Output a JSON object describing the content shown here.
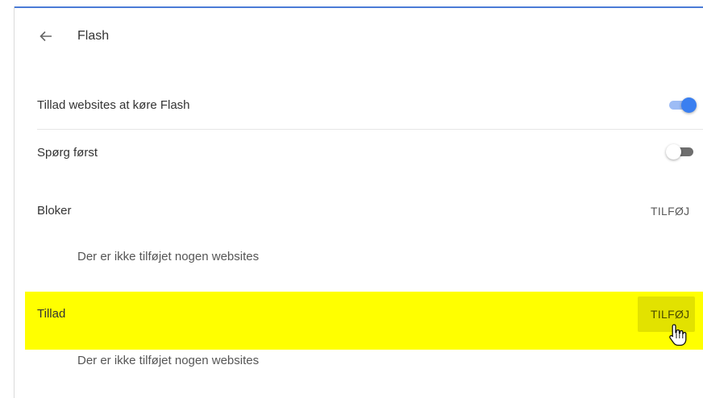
{
  "header": {
    "title": "Flash",
    "back_icon": "arrow-left-icon"
  },
  "settings": {
    "allow_flash": {
      "label": "Tillad websites at køre Flash",
      "enabled": true
    },
    "ask_first": {
      "label": "Spørg først",
      "enabled": false
    }
  },
  "block_section": {
    "label": "Bloker",
    "add_label": "TILFØJ",
    "empty_text": "Der er ikke tilføjet nogen websites"
  },
  "allow_section": {
    "label": "Tillad",
    "add_label": "TILFØJ",
    "empty_text": "Der er ikke tilføjet nogen websites"
  },
  "colors": {
    "accent": "#3a7ff0",
    "highlight": "#ffff00",
    "top_border": "#4a7bd6"
  }
}
